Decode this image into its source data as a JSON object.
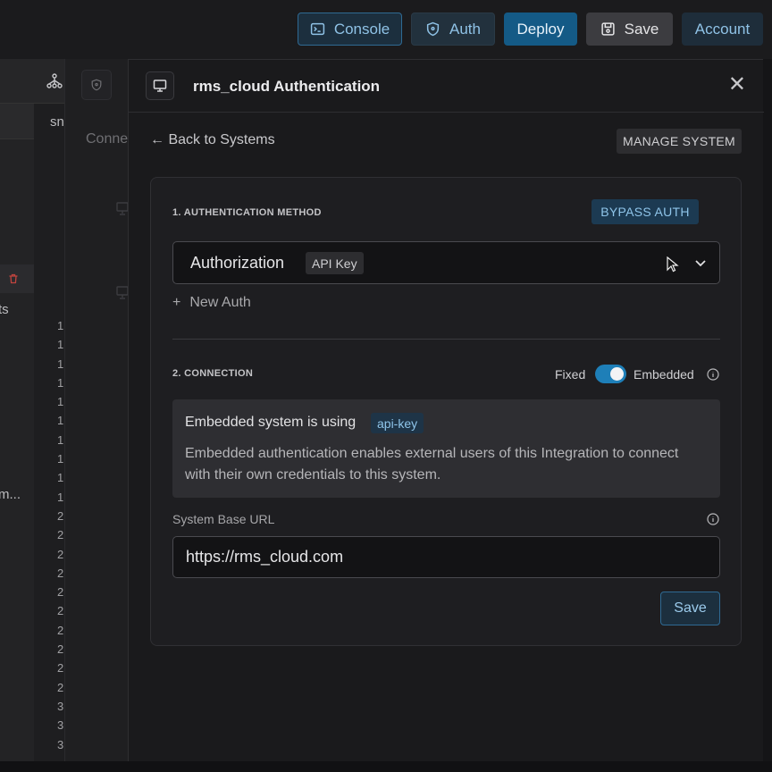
{
  "topbar": {
    "console_label": "Console",
    "auth_label": "Auth",
    "deploy_label": "Deploy",
    "save_label": "Save",
    "account_label": "Account"
  },
  "background": {
    "col_header_fragment": "sn",
    "connections_fragment": "Conne",
    "text_fragment_1": "ts",
    "text_fragment_2": "m...",
    "line_numbers": [
      "1",
      "1",
      "1",
      "1",
      "1",
      "1",
      "1",
      "1",
      "1",
      "1",
      "2",
      "2",
      "2",
      "2",
      "2",
      "2",
      "2",
      "2",
      "2",
      "2",
      "3",
      "3",
      "3"
    ]
  },
  "modal": {
    "title": "rms_cloud Authentication",
    "back_label": "← Back to Systems",
    "manage_label": "MANAGE SYSTEM",
    "auth_method": {
      "section_label": "1. AUTHENTICATION METHOD",
      "bypass_label": "BYPASS AUTH",
      "selected_value": "Authorization",
      "selected_type": "API Key",
      "new_auth_label": "New Auth"
    },
    "connection": {
      "section_label": "2. CONNECTION",
      "fixed_label": "Fixed",
      "embedded_label": "Embedded",
      "toggle_state": "embedded",
      "info_title": "Embedded system is using",
      "info_badge": "api-key",
      "info_description": "Embedded authentication enables external users of this Integration to connect with their own credentials to this system.",
      "url_label": "System Base URL",
      "url_value": "https://rms_cloud.com",
      "save_label": "Save"
    }
  },
  "colors": {
    "accent": "#1e7fb8",
    "deploy_bg": "#145a86",
    "danger": "#c0443e"
  }
}
